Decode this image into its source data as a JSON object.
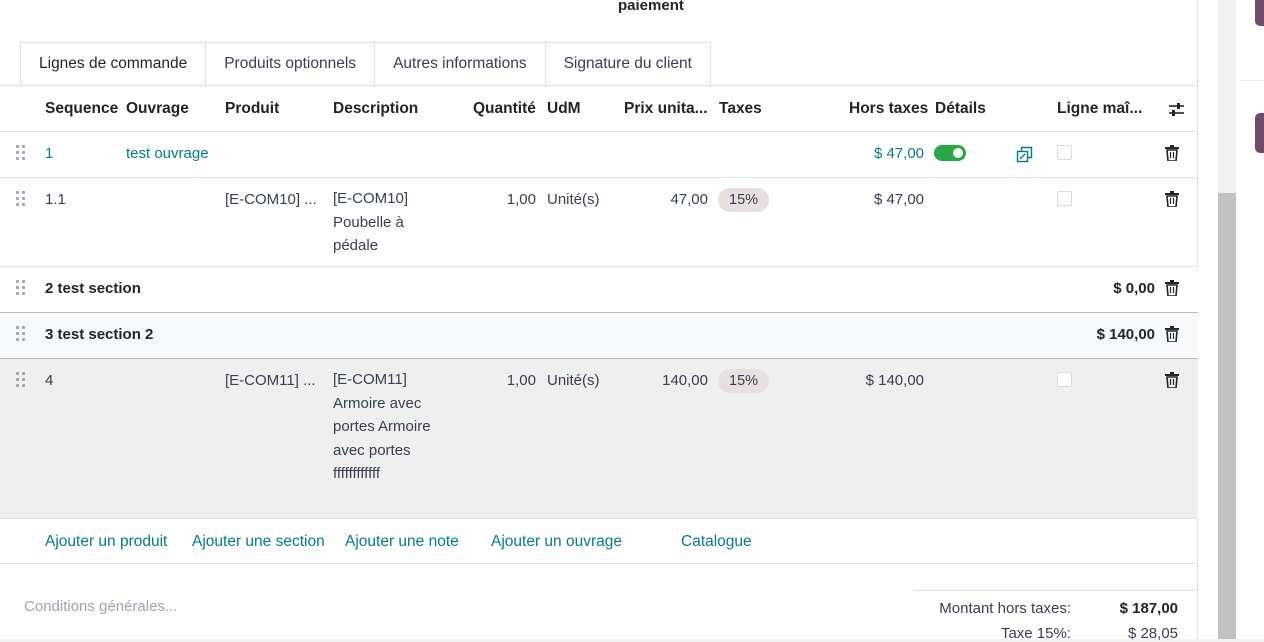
{
  "header": {
    "top_label": "paiement"
  },
  "tabs": [
    {
      "label": "Lignes de commande",
      "active": true
    },
    {
      "label": "Produits optionnels",
      "active": false
    },
    {
      "label": "Autres informations",
      "active": false
    },
    {
      "label": "Signature du client",
      "active": false
    }
  ],
  "columns": {
    "sequence": "Sequence",
    "ouvrage": "Ouvrage",
    "produit": "Produit",
    "description": "Description",
    "quantite": "Quantité",
    "udm": "UdM",
    "prix": "Prix unita...",
    "taxes": "Taxes",
    "hors_taxes": "Hors taxes",
    "details": "Détails",
    "ligne": "Ligne maî..."
  },
  "rows": [
    {
      "type": "ouvrage",
      "sequence": "1",
      "ouvrage": "test ouvrage",
      "hors_taxes": "$ 47,00",
      "details_on": true
    },
    {
      "type": "line",
      "sequence": "1.1",
      "produit": "[E-COM10] ...",
      "description": "[E-COM10] Poubelle à pédale",
      "quantite": "1,00",
      "udm": "Unité(s)",
      "prix": "47,00",
      "taxe": "15%",
      "hors_taxes": "$ 47,00"
    },
    {
      "type": "section",
      "label": "2 test section",
      "total": "$ 0,00"
    },
    {
      "type": "section",
      "label": "3 test section 2",
      "total": "$ 140,00"
    },
    {
      "type": "line",
      "sequence": "4",
      "produit": "[E-COM11] ...",
      "description": "[E-COM11] Armoire avec portes Armoire avec portes ffffffffffff",
      "quantite": "1,00",
      "udm": "Unité(s)",
      "prix": "140,00",
      "taxe": "15%",
      "hors_taxes": "$ 140,00"
    }
  ],
  "actions": {
    "add_product": "Ajouter un produit",
    "add_section": "Ajouter une section",
    "add_note": "Ajouter une note",
    "add_ouvrage": "Ajouter un ouvrage",
    "catalogue": "Catalogue"
  },
  "terms_placeholder": "Conditions générales...",
  "totals": {
    "untaxed_label": "Montant hors taxes:",
    "untaxed_value": "$ 187,00",
    "tax_label": "Taxe 15%:",
    "tax_value": "$ 28,05"
  },
  "colors": {
    "link": "#017e84",
    "toggle_on": "#28a745",
    "brand": "#714b67"
  }
}
